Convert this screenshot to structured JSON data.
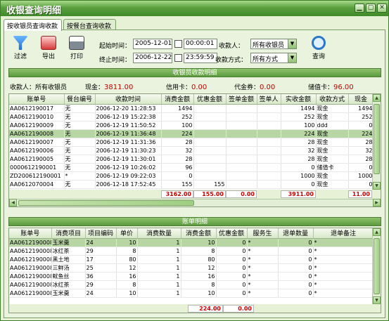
{
  "window": {
    "title": "收银查询明细"
  },
  "tabs": [
    {
      "label": "按收银员查询收款"
    },
    {
      "label": "按餐台查询收款"
    }
  ],
  "toolbar": {
    "filter": "过滤",
    "export": "导出",
    "print": "打印",
    "query": "查询"
  },
  "filters": {
    "start_label": "起始时间：",
    "start_date": "2005-12-01",
    "start_time": "00:00:01",
    "end_label": "终止时间：",
    "end_date": "2006-12-22",
    "end_time": "23:59:59",
    "cashier_label": "收款人：",
    "cashier_value": "所有收银员",
    "method_label": "收款方式：",
    "method_value": "所有方式"
  },
  "summary_section": {
    "title": "收银员收款明细",
    "cashier_label": "收款人：",
    "cashier_value": "所有收银员",
    "cash_label": "现金：",
    "cash_value": "3811.00",
    "credit_label": "信用卡：",
    "credit_value": "0.00",
    "voucher_label": "代金券：",
    "voucher_value": "0.00",
    "stored_label": "储值卡：",
    "stored_value": "96.00"
  },
  "top_table": {
    "headers": [
      "账单号",
      "餐台编号",
      "收款时间",
      "消费金额",
      "优惠金额",
      "签单金额",
      "签单人",
      "实收金额",
      "收款方式",
      "现金"
    ],
    "rows": [
      [
        "AA0612190017",
        "无",
        "2006-12-20 11:28:53",
        "1494",
        "",
        "",
        "",
        "1494",
        "现金",
        "1494"
      ],
      [
        "AA0612190010",
        "无",
        "2006-12-19 15:22:38",
        "252",
        "",
        "",
        "",
        "252",
        "现金",
        "252"
      ],
      [
        "AA0612190009",
        "无",
        "2006-12-19 11:50:52",
        "100",
        "",
        "",
        "",
        "100",
        "ddd",
        "0"
      ],
      [
        "AA0612190008",
        "无",
        "2006-12-19 11:36:48",
        "224",
        "",
        "",
        "",
        "224",
        "现金",
        "224"
      ],
      [
        "AA0612190007",
        "无",
        "2006-12-19 11:31:36",
        "28",
        "",
        "",
        "",
        "28",
        "现金",
        "28"
      ],
      [
        "AA0612190006",
        "无",
        "2006-12-19 11:30:23",
        "32",
        "",
        "",
        "",
        "32",
        "现金",
        "32"
      ],
      [
        "AA0612190005",
        "无",
        "2006-12-19 11:30:01",
        "28",
        "",
        "",
        "",
        "28",
        "现金",
        "28"
      ],
      [
        "0000612190001",
        "无",
        "2006-12-19 10:26:02",
        "96",
        "",
        "",
        "",
        "0",
        "储值卡",
        "0"
      ],
      [
        "ZD200612190001",
        "*",
        "2006-12-19 09:22:03",
        "0",
        "",
        "",
        "",
        "1000",
        "现金",
        "1000"
      ],
      [
        "AA0612070004",
        "无",
        "2006-12-18 17:52:45",
        "155",
        "155",
        "",
        "",
        "0",
        "现金",
        "0"
      ]
    ],
    "totals": {
      "consume": "3162.00",
      "discount": "155.00",
      "sign": "0.00",
      "received": "3911.00",
      "cash": "11.00"
    }
  },
  "detail_section": {
    "title": "账单明细"
  },
  "detail_table": {
    "headers": [
      "账单号",
      "消费项目",
      "项目编码",
      "单价",
      "消费数量",
      "消费金额",
      "优惠金额",
      "服务生",
      "退单数量",
      "退单备注"
    ],
    "rows": [
      [
        "AA0612190008",
        "玉米羹",
        "24",
        "10",
        "1",
        "10",
        "0",
        "*",
        "0",
        "*"
      ],
      [
        "AA0612190008",
        "冰红茶",
        "29",
        "8",
        "1",
        "8",
        "0",
        "*",
        "0",
        "*"
      ],
      [
        "AA0612190008",
        "黑土地",
        "17",
        "80",
        "1",
        "80",
        "0",
        "*",
        "0",
        "*"
      ],
      [
        "AA0612190008",
        "三鲜汤",
        "25",
        "12",
        "1",
        "12",
        "0",
        "*",
        "0",
        "*"
      ],
      [
        "AA0612190008",
        "鱿鱼丝",
        "36",
        "16",
        "1",
        "16",
        "0",
        "*",
        "0",
        "*"
      ],
      [
        "AA0612190008",
        "冰红茶",
        "29",
        "8",
        "1",
        "8",
        "0",
        "*",
        "0",
        "*"
      ],
      [
        "AA0612190008",
        "玉米羹",
        "24",
        "10",
        "1",
        "10",
        "0",
        "*",
        "0",
        "*"
      ]
    ],
    "totals": {
      "consume": "224.00",
      "discount": "0.00"
    }
  }
}
